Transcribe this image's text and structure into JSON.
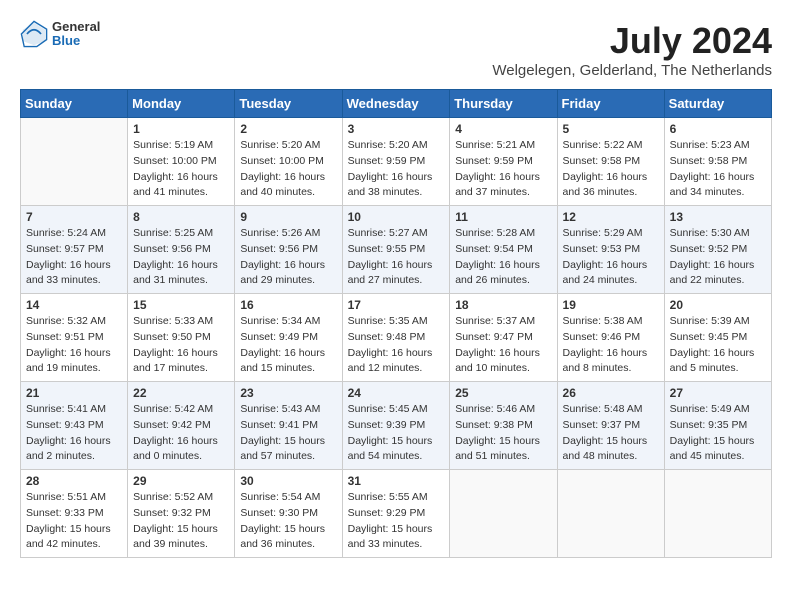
{
  "header": {
    "logo": {
      "line1": "General",
      "line2": "Blue"
    },
    "title": "July 2024",
    "location": "Welgelegen, Gelderland, The Netherlands"
  },
  "weekdays": [
    "Sunday",
    "Monday",
    "Tuesday",
    "Wednesday",
    "Thursday",
    "Friday",
    "Saturday"
  ],
  "weeks": [
    [
      {
        "day": "",
        "empty": true
      },
      {
        "day": "1",
        "sunrise": "5:19 AM",
        "sunset": "10:00 PM",
        "daylight": "16 hours and 41 minutes."
      },
      {
        "day": "2",
        "sunrise": "5:20 AM",
        "sunset": "10:00 PM",
        "daylight": "16 hours and 40 minutes."
      },
      {
        "day": "3",
        "sunrise": "5:20 AM",
        "sunset": "9:59 PM",
        "daylight": "16 hours and 38 minutes."
      },
      {
        "day": "4",
        "sunrise": "5:21 AM",
        "sunset": "9:59 PM",
        "daylight": "16 hours and 37 minutes."
      },
      {
        "day": "5",
        "sunrise": "5:22 AM",
        "sunset": "9:58 PM",
        "daylight": "16 hours and 36 minutes."
      },
      {
        "day": "6",
        "sunrise": "5:23 AM",
        "sunset": "9:58 PM",
        "daylight": "16 hours and 34 minutes."
      }
    ],
    [
      {
        "day": "7",
        "sunrise": "5:24 AM",
        "sunset": "9:57 PM",
        "daylight": "16 hours and 33 minutes."
      },
      {
        "day": "8",
        "sunrise": "5:25 AM",
        "sunset": "9:56 PM",
        "daylight": "16 hours and 31 minutes."
      },
      {
        "day": "9",
        "sunrise": "5:26 AM",
        "sunset": "9:56 PM",
        "daylight": "16 hours and 29 minutes."
      },
      {
        "day": "10",
        "sunrise": "5:27 AM",
        "sunset": "9:55 PM",
        "daylight": "16 hours and 27 minutes."
      },
      {
        "day": "11",
        "sunrise": "5:28 AM",
        "sunset": "9:54 PM",
        "daylight": "16 hours and 26 minutes."
      },
      {
        "day": "12",
        "sunrise": "5:29 AM",
        "sunset": "9:53 PM",
        "daylight": "16 hours and 24 minutes."
      },
      {
        "day": "13",
        "sunrise": "5:30 AM",
        "sunset": "9:52 PM",
        "daylight": "16 hours and 22 minutes."
      }
    ],
    [
      {
        "day": "14",
        "sunrise": "5:32 AM",
        "sunset": "9:51 PM",
        "daylight": "16 hours and 19 minutes."
      },
      {
        "day": "15",
        "sunrise": "5:33 AM",
        "sunset": "9:50 PM",
        "daylight": "16 hours and 17 minutes."
      },
      {
        "day": "16",
        "sunrise": "5:34 AM",
        "sunset": "9:49 PM",
        "daylight": "16 hours and 15 minutes."
      },
      {
        "day": "17",
        "sunrise": "5:35 AM",
        "sunset": "9:48 PM",
        "daylight": "16 hours and 12 minutes."
      },
      {
        "day": "18",
        "sunrise": "5:37 AM",
        "sunset": "9:47 PM",
        "daylight": "16 hours and 10 minutes."
      },
      {
        "day": "19",
        "sunrise": "5:38 AM",
        "sunset": "9:46 PM",
        "daylight": "16 hours and 8 minutes."
      },
      {
        "day": "20",
        "sunrise": "5:39 AM",
        "sunset": "9:45 PM",
        "daylight": "16 hours and 5 minutes."
      }
    ],
    [
      {
        "day": "21",
        "sunrise": "5:41 AM",
        "sunset": "9:43 PM",
        "daylight": "16 hours and 2 minutes."
      },
      {
        "day": "22",
        "sunrise": "5:42 AM",
        "sunset": "9:42 PM",
        "daylight": "16 hours and 0 minutes."
      },
      {
        "day": "23",
        "sunrise": "5:43 AM",
        "sunset": "9:41 PM",
        "daylight": "15 hours and 57 minutes."
      },
      {
        "day": "24",
        "sunrise": "5:45 AM",
        "sunset": "9:39 PM",
        "daylight": "15 hours and 54 minutes."
      },
      {
        "day": "25",
        "sunrise": "5:46 AM",
        "sunset": "9:38 PM",
        "daylight": "15 hours and 51 minutes."
      },
      {
        "day": "26",
        "sunrise": "5:48 AM",
        "sunset": "9:37 PM",
        "daylight": "15 hours and 48 minutes."
      },
      {
        "day": "27",
        "sunrise": "5:49 AM",
        "sunset": "9:35 PM",
        "daylight": "15 hours and 45 minutes."
      }
    ],
    [
      {
        "day": "28",
        "sunrise": "5:51 AM",
        "sunset": "9:33 PM",
        "daylight": "15 hours and 42 minutes."
      },
      {
        "day": "29",
        "sunrise": "5:52 AM",
        "sunset": "9:32 PM",
        "daylight": "15 hours and 39 minutes."
      },
      {
        "day": "30",
        "sunrise": "5:54 AM",
        "sunset": "9:30 PM",
        "daylight": "15 hours and 36 minutes."
      },
      {
        "day": "31",
        "sunrise": "5:55 AM",
        "sunset": "9:29 PM",
        "daylight": "15 hours and 33 minutes."
      },
      {
        "day": "",
        "empty": true
      },
      {
        "day": "",
        "empty": true
      },
      {
        "day": "",
        "empty": true
      }
    ]
  ]
}
